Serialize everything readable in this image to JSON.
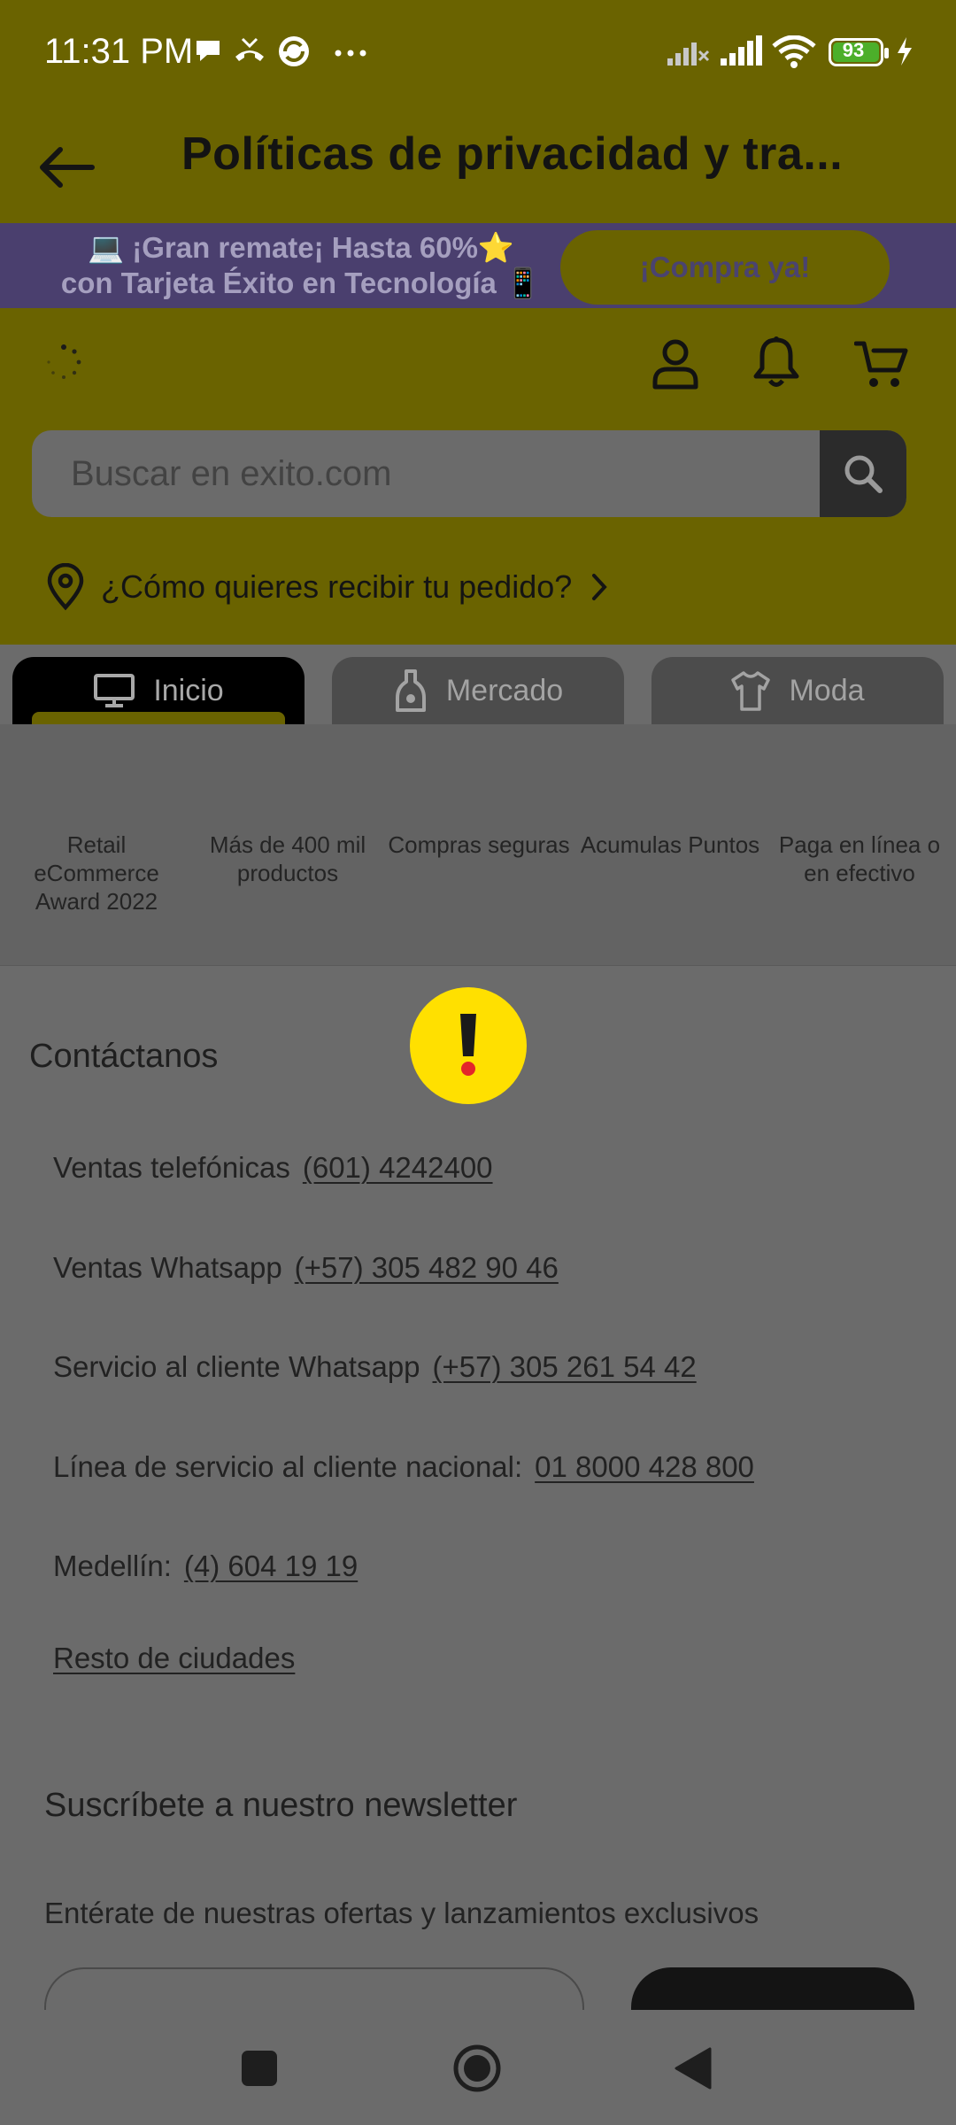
{
  "status_bar": {
    "time": "11:31 PM",
    "battery": "93",
    "icons": [
      "chat-bubble-icon",
      "missed-call-icon",
      "sync-app-icon",
      "more-dots-icon",
      "no-signal-icon",
      "signal-icon",
      "wifi-icon",
      "battery-icon",
      "charging-icon"
    ]
  },
  "app_bar": {
    "title": "Políticas de privacidad y tra...",
    "back_icon": "arrow-left-icon"
  },
  "promo": {
    "line1": "💻 ¡Gran remate¡ Hasta 60%⭐",
    "line2": "con Tarjeta Éxito en Tecnología 📱",
    "button": "¡Compra ya!"
  },
  "header": {
    "icons": [
      "loading-spinner-icon",
      "user-icon",
      "bell-icon",
      "cart-icon"
    ],
    "search_placeholder": "Buscar en exito.com",
    "delivery_prompt": "¿Cómo quieres recibir tu pedido?"
  },
  "tabs": [
    {
      "label": "Inicio",
      "icon": "monitor-icon",
      "active": true
    },
    {
      "label": "Mercado",
      "icon": "bottle-icon",
      "active": false
    },
    {
      "label": "Moda",
      "icon": "shirt-icon",
      "active": false
    }
  ],
  "features": [
    "Retail eCommerce Award 2022",
    "Más de 400 mil productos",
    "Compras seguras",
    "Acumulas Puntos",
    "Paga en línea o en efectivo"
  ],
  "contact": {
    "title": "Contáctanos",
    "rows": [
      {
        "label": "Ventas telefónicas",
        "value": "(601) 4242400"
      },
      {
        "label": "Ventas Whatsapp",
        "value": "(+57) 305 482 90 46"
      },
      {
        "label": "Servicio al cliente Whatsapp",
        "value": "(+57) 305 261 54 42"
      },
      {
        "label": "Línea de servicio al cliente nacional:",
        "value": "01 8000 428 800"
      },
      {
        "label": "Medellín:",
        "value": "(4) 604 19 19"
      }
    ],
    "rest_link": "Resto de ciudades"
  },
  "newsletter": {
    "title": "Suscríbete a nuestro newsletter",
    "subtitle": "Entérate de nuestras ofertas y lanzamientos exclusivos"
  },
  "nav_bar": {
    "icons": [
      "recents-square-icon",
      "home-circle-icon",
      "back-triangle-icon"
    ]
  },
  "colors": {
    "header_olive": "#6a6300",
    "overlay_gray": "#6b6b6b",
    "promo_purple": "#4a3f6e",
    "warning_yellow": "#ffe000",
    "warning_red": "#e3262a"
  }
}
